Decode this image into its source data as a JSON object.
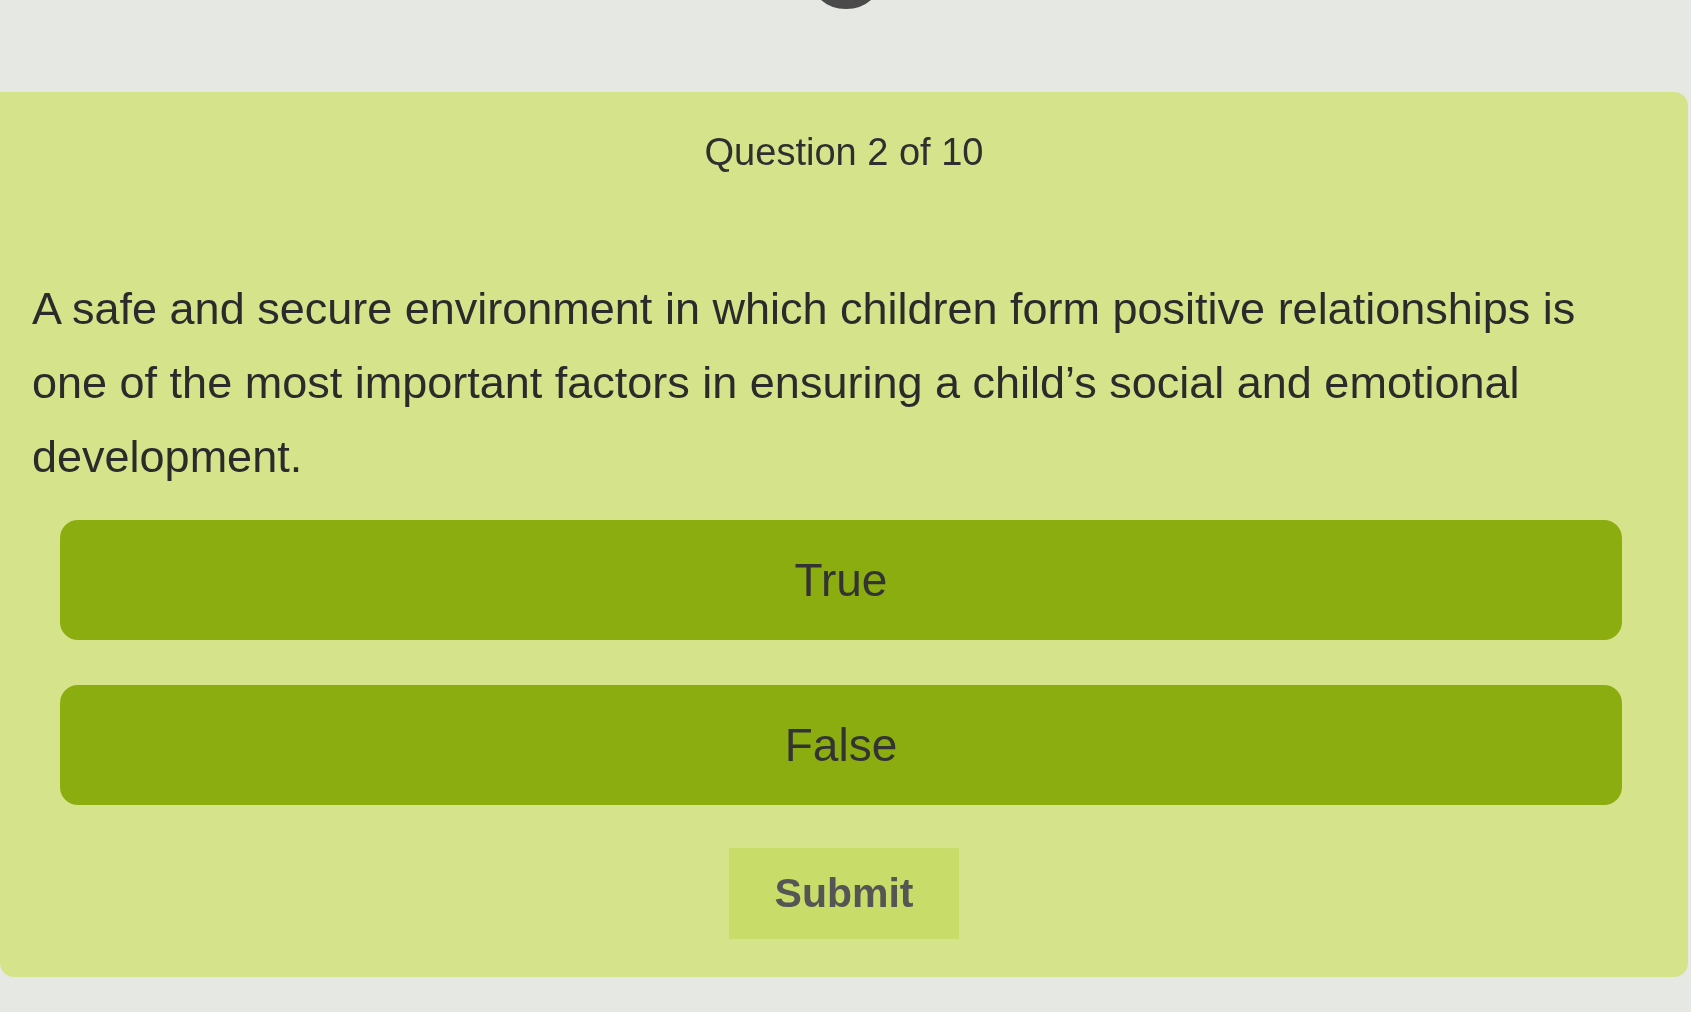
{
  "header": {
    "counter": "Question 2 of 10"
  },
  "question": {
    "text": "A safe and secure environment in which children form positive relationships is one of the most important factors in ensuring a child’s social and emotional development."
  },
  "options": [
    {
      "label": "True",
      "selected": false
    },
    {
      "label": "False",
      "selected": false
    }
  ],
  "submit_button": {
    "label": "Submit",
    "disabled": true
  }
}
